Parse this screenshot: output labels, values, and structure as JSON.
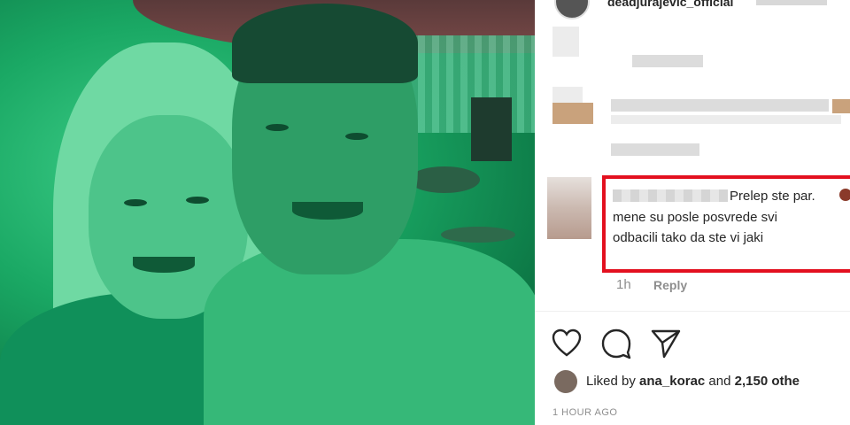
{
  "post": {
    "username": "deadjurajevic_official",
    "comment": {
      "line1": "Prelep ste par.",
      "line2": "mene su posle posvrede svi",
      "line3": "odbacili tako da ste vi jaki",
      "time": "1h",
      "reply_label": "Reply"
    },
    "liked": {
      "prefix": "Liked by ",
      "user": "ana_korac",
      "middle": " and ",
      "count": "2,150 othe"
    },
    "timestamp": "1 HOUR AGO"
  },
  "icons": [
    "heart-icon",
    "comment-icon",
    "share-icon"
  ],
  "colors": {
    "highlight": "#e3101f",
    "text": "#262626",
    "muted": "#8e8e8e"
  }
}
